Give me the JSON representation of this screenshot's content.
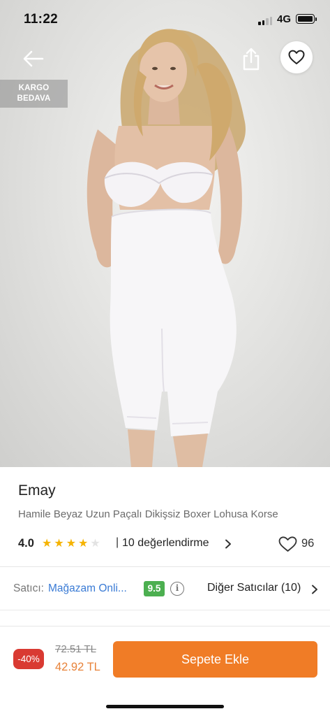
{
  "status_bar": {
    "time": "11:22",
    "network": "4G",
    "signal_bars_active": 2,
    "signal_bars_total": 4
  },
  "header": {
    "back_icon": "arrow-left-icon",
    "share_icon": "share-icon",
    "favorite_icon": "heart-outline-icon"
  },
  "badge": {
    "line1": "KARGO",
    "line2": "BEDAVA"
  },
  "product": {
    "brand": "Emay",
    "name": "Hamile Beyaz Uzun Paçalı Dikişsiz Boxer Lohusa Korse",
    "rating": "4.0",
    "stars": {
      "filled": 4,
      "total": 5
    },
    "rating_separator": "|",
    "review_count_text": "10 değerlendirme",
    "favorite_count": "96"
  },
  "seller": {
    "label": "Satıcı:",
    "name": "Mağazam Onli...",
    "score": "9.5",
    "info_icon": "i",
    "other_sellers": "Diğer Satıcılar (10)"
  },
  "purchase": {
    "discount": "-40%",
    "old_price": "72.51 TL",
    "new_price": "42.92 TL",
    "add_to_cart": "Sepete Ekle"
  },
  "colors": {
    "accent_orange": "#f07c26",
    "price_orange": "#e8833a",
    "discount_red": "#d93a32",
    "seller_blue": "#3a7bd5",
    "score_green": "#4caf50",
    "star_yellow": "#f5b301",
    "star_empty": "#e3e3e3"
  }
}
